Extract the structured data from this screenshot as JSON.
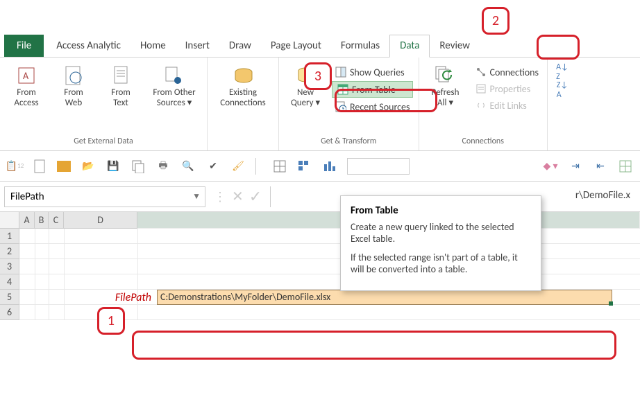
{
  "tabs": {
    "file": "File",
    "access_analytic": "Access Analytic",
    "home": "Home",
    "insert": "Insert",
    "draw": "Draw",
    "page_layout": "Page Layout",
    "formulas": "Formulas",
    "data": "Data",
    "review": "Review"
  },
  "ribbon": {
    "get_external_data": {
      "label": "Get External Data",
      "from_access": {
        "l1": "From",
        "l2": "Access"
      },
      "from_web": {
        "l1": "From",
        "l2": "Web"
      },
      "from_text": {
        "l1": "From",
        "l2": "Text"
      },
      "from_other": {
        "l1": "From Other",
        "l2": "Sources ▾"
      },
      "existing_conn": {
        "l1": "Existing",
        "l2": "Connections"
      }
    },
    "get_transform": {
      "label": "Get & Transform",
      "new_query": {
        "l1": "New",
        "l2": "Query ▾"
      },
      "show_queries": "Show Queries",
      "from_table": "From Table",
      "recent_sources": "Recent Sources"
    },
    "connections": {
      "label": "Connections",
      "refresh_all": {
        "l1": "Refresh",
        "l2": "All ▾"
      },
      "connections": "Connections",
      "properties": "Properties",
      "edit_links": "Edit Links"
    }
  },
  "namebox": "FilePath",
  "formula_bar_truncated": "r\\DemoFile.x",
  "tooltip": {
    "title": "From Table",
    "p1": "Create a new query linked to the selected Excel table.",
    "p2": "If the selected range isn't part of a table, it will be converted into a table."
  },
  "columns": [
    "A",
    "B",
    "C",
    "D"
  ],
  "rows": [
    "1",
    "2",
    "3",
    "4",
    "5",
    "6"
  ],
  "cell_label": "FilePath",
  "cell_value": "C:Demonstrations\\MyFolder\\DemoFile.xlsx",
  "callouts": {
    "c1": "1",
    "c2": "2",
    "c3": "3"
  }
}
